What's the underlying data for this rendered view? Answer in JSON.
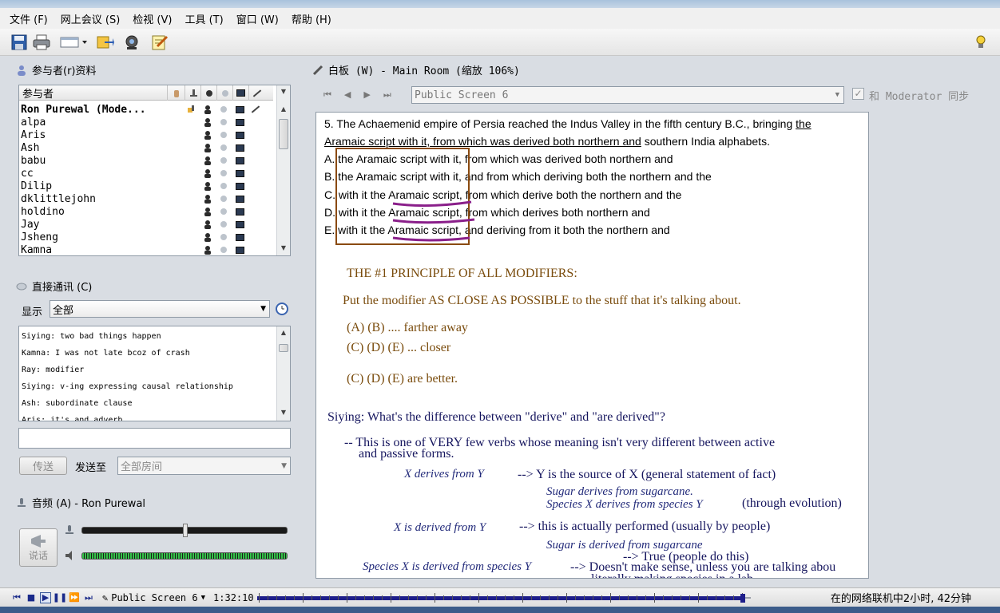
{
  "menu": {
    "items": [
      "文件 (F)",
      "网上会议 (S)",
      "检视 (V)",
      "工具 (T)",
      "窗口 (W)",
      "帮助 (H)"
    ]
  },
  "participants": {
    "header": "参与者(r)资料",
    "column_header": "参与者",
    "rows": [
      "Ron Purewal (Mode...",
      "alpa",
      "Aris",
      "Ash",
      "babu",
      "cc",
      "Dilip",
      "dklittlejohn",
      "holdino",
      "Jay",
      "Jsheng",
      "Kamna"
    ]
  },
  "chat": {
    "header": "直接通讯 (C)",
    "show_label": "显示",
    "show_value": "全部",
    "messages": [
      "Siying: two bad things happen",
      "Kamna: I was not late bcoz of crash",
      "Ray: modifier",
      "Siying: v-ing expressing causal relationship",
      "Ash: subordinate clause",
      "Aris: it's and adverb"
    ],
    "send_label": "传送",
    "send_to_label": "发送至",
    "send_to_value": "全部房间"
  },
  "audio": {
    "header": "音频 (A) - Ron Purewal",
    "talk_label": "说话",
    "mic_level": 0.5,
    "speaker_level": 1.0
  },
  "whiteboard": {
    "header": "白板 (W) - Main Room (缩放 106%)",
    "screen_select": "Public Screen 6",
    "sync_label": "和 Moderator 同步",
    "content": {
      "q_line1_a": "5. The Achaemenid empire of Persia reached the Indus Valley in the fifth century B.C., bringing ",
      "q_line1_b": "the",
      "q_line2_a": "Aramaic script with it, from which was derived both northern and",
      "q_line2_b": " southern India alphabets.",
      "opt_a": "A. the Aramaic script with it, from which was derived both northern and",
      "opt_b": "B. the Aramaic script with it, and from which deriving both the northern and the",
      "opt_c": "C. with it the Aramaic script, from which derive both the northern and the",
      "opt_d": "D. with it the Aramaic script, from which derives both northern and",
      "opt_e": "E. with it the Aramaic script, and deriving from it both the northern and",
      "principle_title": "THE #1 PRINCIPLE OF ALL MODIFIERS:",
      "principle_text": "Put the modifier AS CLOSE AS POSSIBLE to the stuff that it's talking about.",
      "ab_far": "(A) (B) .... farther away",
      "cde_close": "(C) (D) (E) ... closer",
      "cde_better": "(C) (D) (E) are better.",
      "siying_q": "Siying: What's the difference between \"derive\" and \"are derived\"?",
      "note_1": "-- This is one of VERY few verbs whose meaning isn't very different between active",
      "note_2": "and passive forms.",
      "x_derives": "X derives from Y",
      "x_derives_meaning": "--> Y is the source of X   (general statement of fact)",
      "ex_sugar_derives": "Sugar derives from sugarcane.",
      "ex_species_derives": "Species X derives from species Y",
      "ex_species_note": "(through evolution)",
      "x_is_derived": "X is derived from Y",
      "x_is_derived_meaning": "--> this is actually performed (usually by people)",
      "ex_sugar_derived": "Sugar is derived from sugarcane",
      "ex_true": "--> True (people do this)",
      "ex_species_derived": "Species X is derived from species Y",
      "ex_nonsense": "--> Doesn't make sense, unless you are talking abou",
      "ex_cut": "literally making species in a lab"
    }
  },
  "status": {
    "screen": "Public Screen 6",
    "time": "1:32:10",
    "progress": 0.99,
    "online": "在的网络联机中2小时, 42分钟"
  }
}
